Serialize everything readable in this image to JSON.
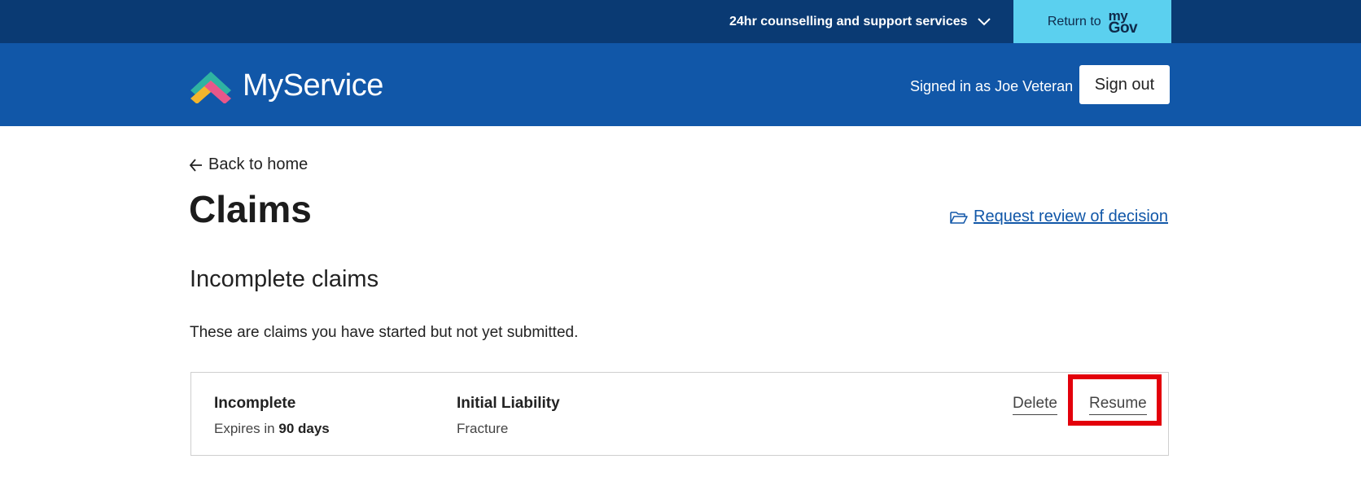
{
  "topbar": {
    "support_label": "24hr counselling and support services",
    "support_icon": "chevron-down-icon",
    "return_label": "Return to",
    "mygov_my": "my",
    "mygov_gov": "Gov"
  },
  "header": {
    "brand": "MyService",
    "signed_in_text": "Signed in as Joe Veteran",
    "signout_label": "Sign out",
    "colors": {
      "topbar": "#0a3a73",
      "header": "#1157a8",
      "return_button": "#5bd0ef"
    }
  },
  "main": {
    "back_label": "Back to home",
    "title": "Claims",
    "review_label": "Request review of decision",
    "section_title": "Incomplete claims",
    "section_desc": "These are claims you have started but not yet submitted.",
    "claims": [
      {
        "status": "Incomplete",
        "expires_prefix": "Expires in",
        "expires_value": "90 days",
        "type": "Initial Liability",
        "subtype": "Fracture",
        "delete_label": "Delete",
        "resume_label": "Resume"
      }
    ],
    "highlight_color": "#e3000b"
  }
}
